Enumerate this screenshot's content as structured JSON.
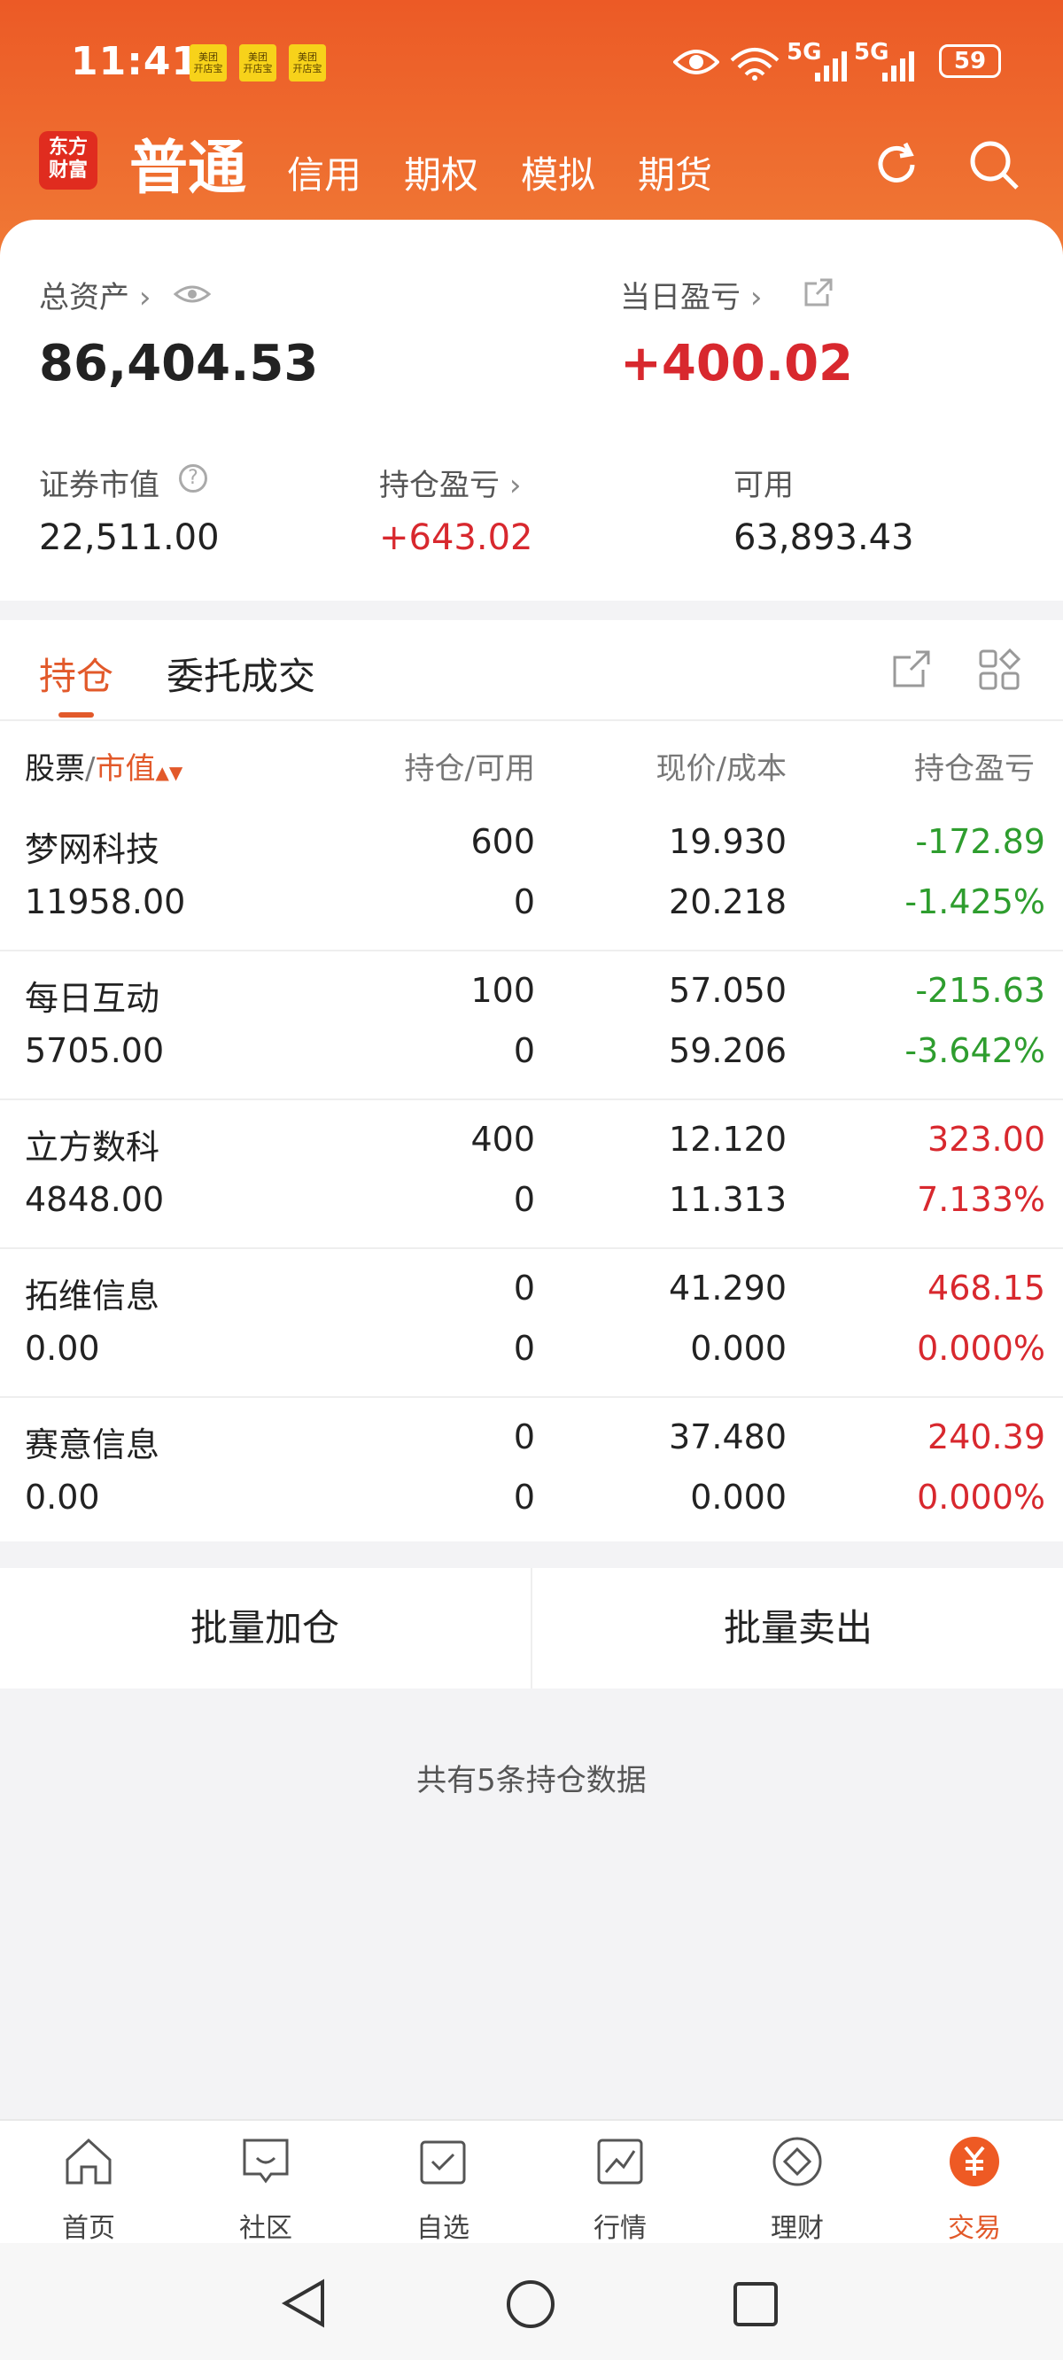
{
  "status_bar": {
    "time": "11:41",
    "badge_text": "美团\n开店宝",
    "signal_1": "5G",
    "signal_2": "5G",
    "battery": "59"
  },
  "nav": {
    "logo": "东方\n财富",
    "tabs": [
      "普通",
      "信用",
      "期权",
      "模拟",
      "期货"
    ]
  },
  "summary": {
    "total_assets_label": "总资产",
    "total_assets": "86,404.53",
    "daily_pl_label": "当日盈亏",
    "daily_pl": "+400.02",
    "market_value_label": "证券市值",
    "market_value": "22,511.00",
    "position_pl_label": "持仓盈亏",
    "position_pl": "+643.02",
    "available_label": "可用",
    "available": "63,893.43"
  },
  "section_tabs": [
    "持仓",
    "委托成交"
  ],
  "table": {
    "headers": {
      "stock": "股票",
      "slash": "/",
      "mv": "市值",
      "hold": "持仓/可用",
      "price": "现价/成本",
      "pl": "持仓盈亏"
    },
    "rows": [
      {
        "name": "梦网科技",
        "value": "11958.00",
        "position": "600",
        "available": "0",
        "price": "19.930",
        "cost": "20.218",
        "pl": "-172.89",
        "pl_pct": "-1.425%",
        "tone": "green"
      },
      {
        "name": "每日互动",
        "value": "5705.00",
        "position": "100",
        "available": "0",
        "price": "57.050",
        "cost": "59.206",
        "pl": "-215.63",
        "pl_pct": "-3.642%",
        "tone": "green"
      },
      {
        "name": "立方数科",
        "value": "4848.00",
        "position": "400",
        "available": "0",
        "price": "12.120",
        "cost": "11.313",
        "pl": "323.00",
        "pl_pct": "7.133%",
        "tone": "red"
      },
      {
        "name": "拓维信息",
        "value": "0.00",
        "position": "0",
        "available": "0",
        "price": "41.290",
        "cost": "0.000",
        "pl": "468.15",
        "pl_pct": "0.000%",
        "tone": "red"
      },
      {
        "name": "赛意信息",
        "value": "0.00",
        "position": "0",
        "available": "0",
        "price": "37.480",
        "cost": "0.000",
        "pl": "240.39",
        "pl_pct": "0.000%",
        "tone": "red"
      }
    ]
  },
  "actions": {
    "batch_add": "批量加仓",
    "batch_sell": "批量卖出"
  },
  "count_text": "共有5条持仓数据",
  "bottom_nav": [
    "首页",
    "社区",
    "自选",
    "行情",
    "理财",
    "交易"
  ],
  "colors": {
    "accent": "#e2592a",
    "header": "#ec5a26",
    "up": "#d8282e",
    "down": "#2e9d2e"
  }
}
